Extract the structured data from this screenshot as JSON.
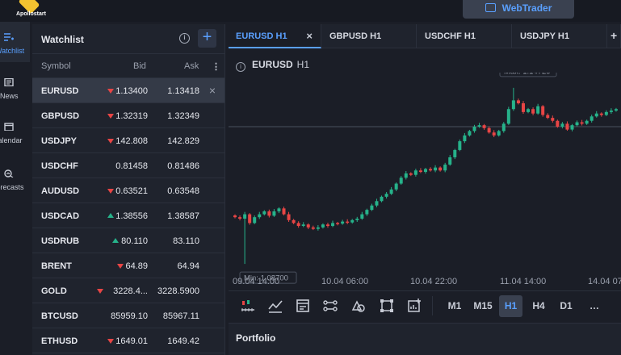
{
  "app": {
    "logo_text": "Apollostart",
    "webtrader_label": "WebTrader"
  },
  "nav": [
    {
      "label": "Watchlist",
      "icon": "watchlist-icon",
      "active": true
    },
    {
      "label": "News",
      "icon": "news-icon",
      "active": false
    },
    {
      "label": "Calendar",
      "icon": "calendar-icon",
      "active": false
    },
    {
      "label": "Forecasts",
      "icon": "forecasts-icon",
      "active": false
    }
  ],
  "watchlist": {
    "title": "Watchlist",
    "columns": {
      "symbol": "Symbol",
      "bid": "Bid",
      "ask": "Ask"
    },
    "rows": [
      {
        "symbol": "EURUSD",
        "bid": "1.13400",
        "ask": "1.13418",
        "dir": "down",
        "selected": true
      },
      {
        "symbol": "GBPUSD",
        "bid": "1.32319",
        "ask": "1.32349",
        "dir": "down"
      },
      {
        "symbol": "USDJPY",
        "bid": "142.808",
        "ask": "142.829",
        "dir": "down"
      },
      {
        "symbol": "USDCHF",
        "bid": "0.81458",
        "ask": "0.81486",
        "dir": "none"
      },
      {
        "symbol": "AUDUSD",
        "bid": "0.63521",
        "ask": "0.63548",
        "dir": "down"
      },
      {
        "symbol": "USDCAD",
        "bid": "1.38556",
        "ask": "1.38587",
        "dir": "up"
      },
      {
        "symbol": "USDRUB",
        "bid": "80.110",
        "ask": "83.110",
        "dir": "up"
      },
      {
        "symbol": "BRENT",
        "bid": "64.89",
        "ask": "64.94",
        "dir": "down"
      },
      {
        "symbol": "GOLD",
        "bid": "3228.4...",
        "ask": "3228.5900",
        "dir": "down"
      },
      {
        "symbol": "BTCUSD",
        "bid": "85959.10",
        "ask": "85967.11",
        "dir": "none"
      },
      {
        "symbol": "ETHUSD",
        "bid": "1649.01",
        "ask": "1649.42",
        "dir": "down"
      }
    ]
  },
  "tabs": [
    {
      "label": "EURUSD H1",
      "active": true
    },
    {
      "label": "GBPUSD H1",
      "active": false
    },
    {
      "label": "USDCHF H1",
      "active": false
    },
    {
      "label": "USDJPY H1",
      "active": false
    }
  ],
  "chart_header": {
    "symbol": "EURUSD",
    "timeframe": "H1"
  },
  "chart_data": {
    "type": "candlestick",
    "symbol": "EURUSD",
    "timeframe": "H1",
    "x_tick_labels": [
      "09.04 14:00",
      "10.04 06:00",
      "10.04 22:00",
      "11.04 14:00",
      "14.04 07"
    ],
    "max_label": "Max: 1.14729",
    "min_label": "Min: 1.08700",
    "max_value": 1.14729,
    "min_value": 1.087,
    "current_price": 1.134,
    "colors": {
      "up": "#26b28a",
      "down": "#e84545"
    },
    "closes": [
      1.103,
      1.1025,
      1.104,
      1.101,
      1.103,
      1.104,
      1.105,
      1.1035,
      1.105,
      1.106,
      1.104,
      1.102,
      1.101,
      1.1,
      1.1005,
      1.0995,
      1.099,
      1.0995,
      1.1005,
      1.1,
      1.101,
      1.1008,
      1.1015,
      1.1012,
      1.102,
      1.1025,
      1.104,
      1.1055,
      1.107,
      1.1085,
      1.11,
      1.111,
      1.1125,
      1.1145,
      1.1165,
      1.118,
      1.1175,
      1.119,
      1.1185,
      1.1195,
      1.119,
      1.12,
      1.119,
      1.121,
      1.1235,
      1.126,
      1.129,
      1.131,
      1.1325,
      1.134,
      1.1345,
      1.1335,
      1.132,
      1.131,
      1.1325,
      1.135,
      1.14,
      1.143,
      1.142,
      1.139,
      1.14,
      1.1385,
      1.141,
      1.138,
      1.137,
      1.136,
      1.134,
      1.135,
      1.133,
      1.1345,
      1.1355,
      1.135,
      1.136,
      1.1375,
      1.1385,
      1.138,
      1.139,
      1.1395,
      1.14
    ]
  },
  "timeframes": [
    "M1",
    "M15",
    "H1",
    "H4",
    "D1",
    "…"
  ],
  "active_timeframe": "H1",
  "tools": [
    "candles-tool-icon",
    "indicator-tool-icon",
    "calendar-tool-icon",
    "path-tool-icon",
    "shapes-tool-icon",
    "frame-tool-icon",
    "add-chart-tool-icon"
  ],
  "portfolio": {
    "title": "Portfolio"
  }
}
